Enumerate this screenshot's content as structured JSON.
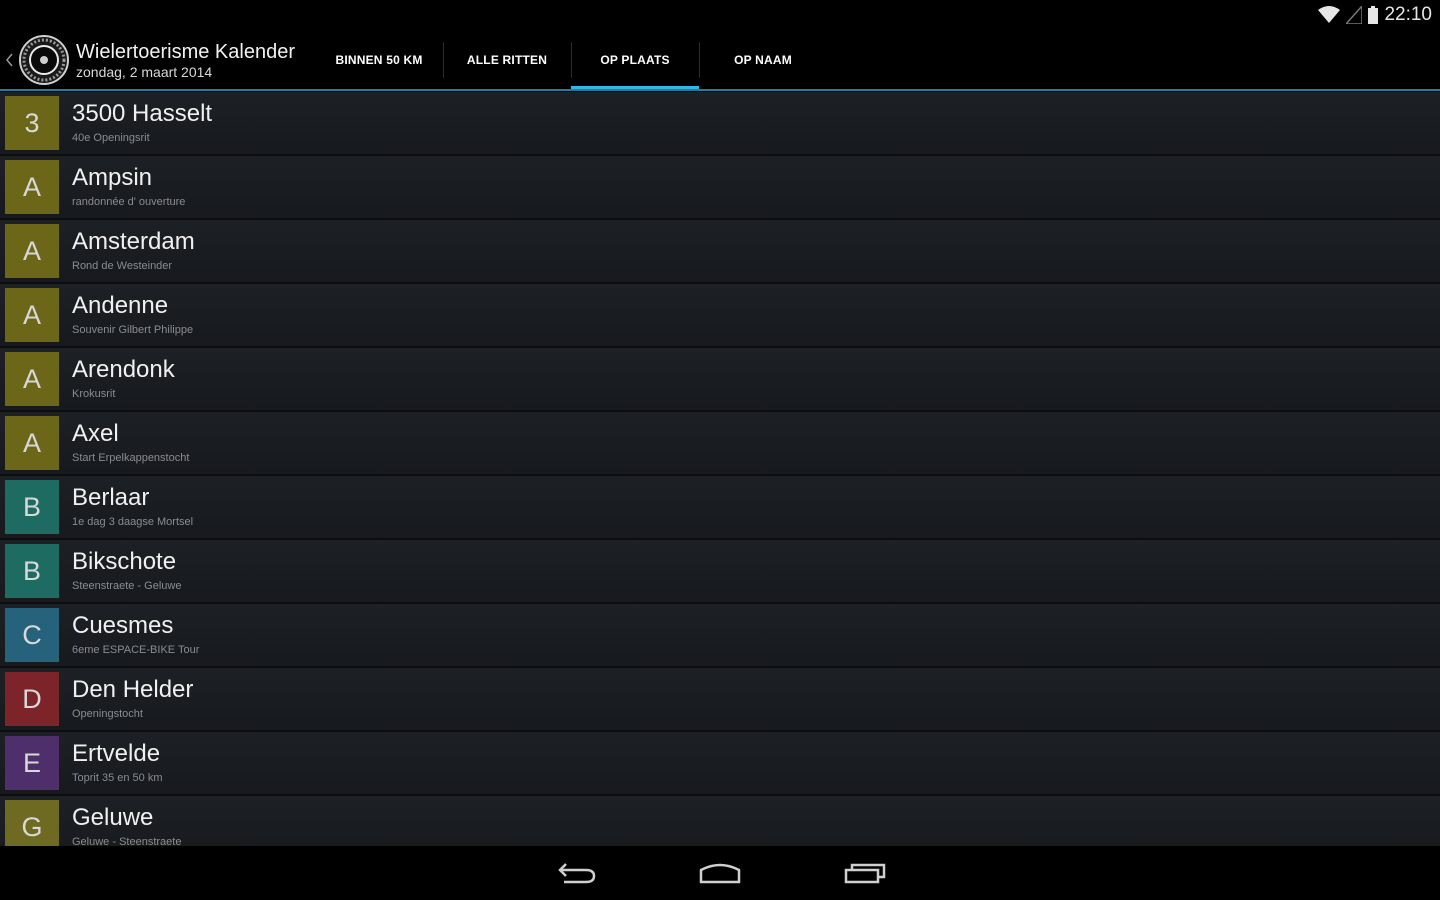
{
  "status_bar": {
    "time": "22:10",
    "icons": [
      "wifi-icon",
      "signal-icon",
      "battery-icon"
    ]
  },
  "action_bar": {
    "title": "Wielertoerisme Kalender",
    "subtitle": "zondag, 2 maart 2014",
    "icons": [
      "up-caret-icon",
      "app-logo-icon"
    ]
  },
  "tabs": [
    {
      "label": "BINNEN 50 KM",
      "selected": false
    },
    {
      "label": "ALLE RITTEN",
      "selected": false
    },
    {
      "label": "OP PLAATS",
      "selected": true
    },
    {
      "label": "OP NAAM",
      "selected": false
    }
  ],
  "list": {
    "rows": [
      {
        "letter": "3",
        "title": "3500 Hasselt",
        "subtitle": "40e Openingsrit",
        "color": "#6b6618"
      },
      {
        "letter": "A",
        "title": "Ampsin",
        "subtitle": "randonnée d' ouverture",
        "color": "#6b6618"
      },
      {
        "letter": "A",
        "title": "Amsterdam",
        "subtitle": "Rond de Westeinder",
        "color": "#6b6618"
      },
      {
        "letter": "A",
        "title": "Andenne",
        "subtitle": "Souvenir Gilbert Philippe",
        "color": "#6b6618"
      },
      {
        "letter": "A",
        "title": "Arendonk",
        "subtitle": "Krokusrit",
        "color": "#6b6618"
      },
      {
        "letter": "A",
        "title": "Axel",
        "subtitle": "Start Erpelkappenstocht",
        "color": "#6b6618"
      },
      {
        "letter": "B",
        "title": "Berlaar",
        "subtitle": "1e dag 3 daagse Mortsel",
        "color": "#1e6b62"
      },
      {
        "letter": "B",
        "title": "Bikschote",
        "subtitle": "Steenstraete - Geluwe",
        "color": "#1e6b62"
      },
      {
        "letter": "C",
        "title": "Cuesmes",
        "subtitle": "6eme ESPACE-BIKE Tour",
        "color": "#26627c"
      },
      {
        "letter": "D",
        "title": "Den Helder",
        "subtitle": "Openingstocht",
        "color": "#7c2429"
      },
      {
        "letter": "E",
        "title": "Ertvelde",
        "subtitle": "Toprit 35 en 50 km",
        "color": "#4e2f6b"
      },
      {
        "letter": "G",
        "title": "Geluwe",
        "subtitle": "Geluwe - Steenstraete",
        "color": "#6e6a22"
      }
    ]
  },
  "nav_bar": {
    "icons": [
      "back-icon",
      "home-icon",
      "recent-apps-icon"
    ]
  }
}
